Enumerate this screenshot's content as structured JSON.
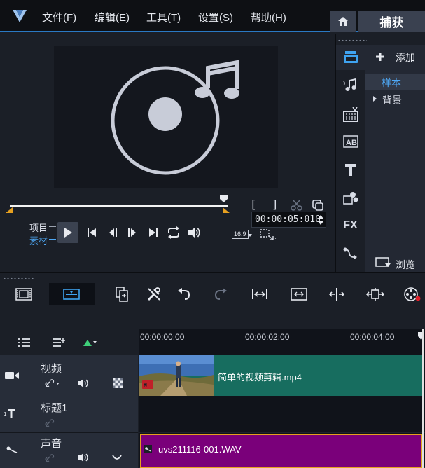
{
  "menu": {
    "file": "文件(F)",
    "edit": "编辑(E)",
    "tools": "工具(T)",
    "settings": "设置(S)",
    "help": "帮助(H)",
    "capture_tab": "捕获"
  },
  "player": {
    "mode_project": "项目",
    "mode_clip": "素材",
    "ratio": "16:9",
    "timecode": "00:00:05:010"
  },
  "library": {
    "add_label": "添加",
    "sample_label": "样本",
    "background_label": "背景",
    "browse_label": "浏览",
    "fx_label": "FX"
  },
  "ruler": {
    "t0": "00:00:00:00",
    "t1": "00:00:02:00",
    "t2": "00:00:04:00"
  },
  "tracks": {
    "video_name": "视频",
    "title_name": "标题1",
    "title_prefix": "1",
    "audio_name": "声音",
    "video_clip": "简单的视频剪辑.mp4",
    "audio_clip": "uvs211116-001.WAV"
  },
  "colors": {
    "accent": "#2a79c4",
    "video_clip": "#176d5f",
    "audio_clip": "#7a007a",
    "audio_border": "#e6a020",
    "selected_text": "#4ea8f5"
  }
}
